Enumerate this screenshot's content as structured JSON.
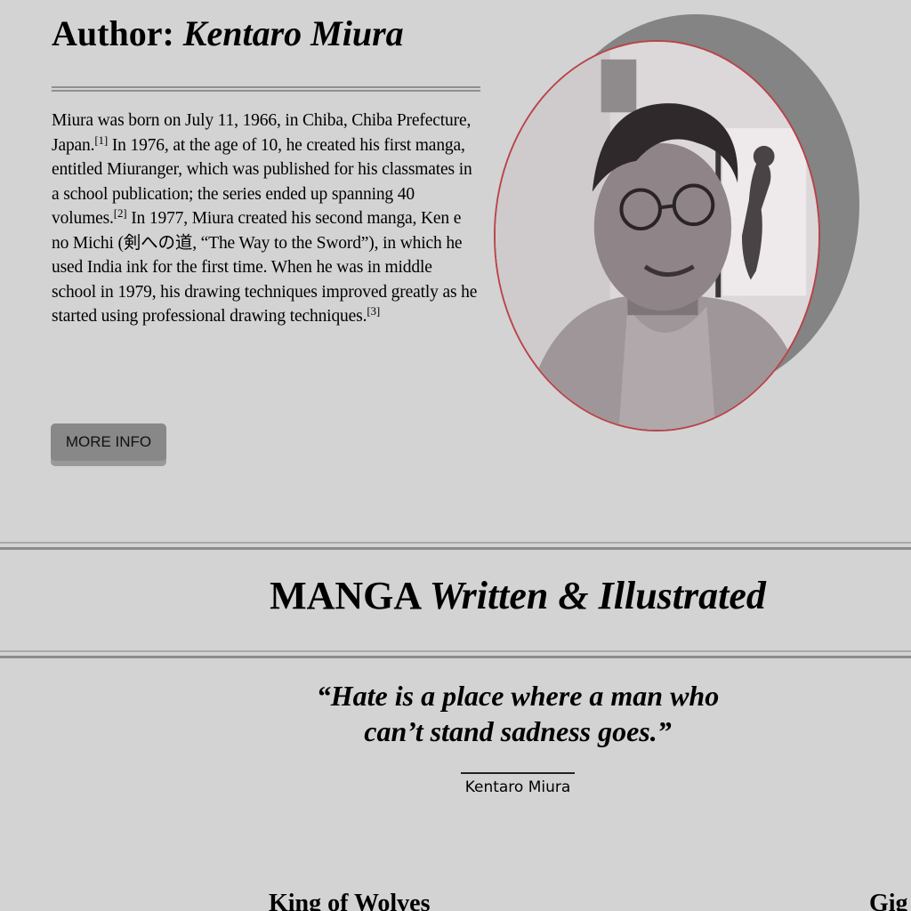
{
  "author": {
    "label": "Author:",
    "name": "Kentaro Miura"
  },
  "bio": {
    "p1": "Miura was born on July 11, 1966, in Chiba, Chiba Prefecture, Japan.",
    "ref1": "[1]",
    "p2": " In 1976, at the age of 10, he created his first manga, entitled Miuranger, which was published for his classmates in a school publication; the series ended up spanning 40 volumes.",
    "ref2": "[2]",
    "p3": " In 1977, Miura created his second manga, Ken e no Michi (剣への道, “The Way to the Sword”), in which he used India ink for the first time. When he was in middle school in 1979, his drawing techniques improved greatly as he started using professional drawing techniques.",
    "ref3": "[3]"
  },
  "more_info_label": "MORE INFO",
  "photo": {
    "icon": "author-portrait-photo",
    "frame_color": "#b8444a"
  },
  "manga_section": {
    "title_bold": "MANGA",
    "title_italic": "Written & Illustrated"
  },
  "quote": {
    "line1": "“Hate is a place where a man who",
    "line2": "can’t stand sadness goes.”",
    "attribution": "Kentaro Miura"
  },
  "books": [
    {
      "title": "King of Wolves"
    },
    {
      "title": "Gig"
    }
  ]
}
